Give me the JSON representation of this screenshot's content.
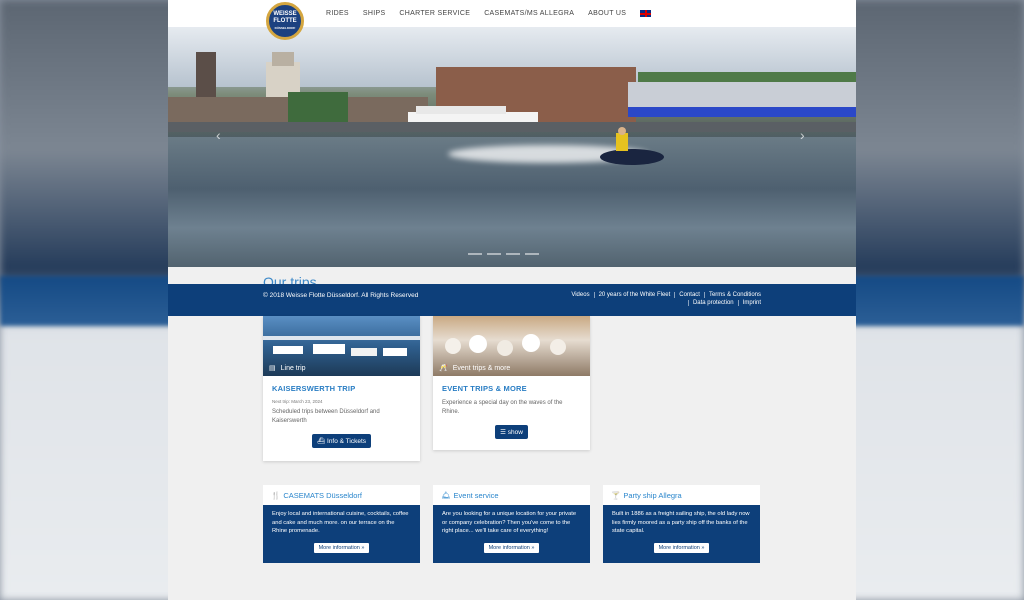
{
  "header": {
    "logo_text": [
      "WEISSE",
      "FLOTTE",
      "DÜSSELDORF"
    ],
    "nav": [
      "RIDES",
      "SHIPS",
      "CHARTER SERVICE",
      "CASEMATS/MS ALLEGRA",
      "ABOUT US"
    ]
  },
  "hero": {
    "prev_icon": "chevron-left-icon",
    "next_icon": "chevron-right-icon"
  },
  "section": {
    "title": "Our trips"
  },
  "footer": {
    "copyright": "© 2018 Weisse Flotte Düsseldorf. All Rights Reserved",
    "links": [
      "Videos",
      "20 years of the White Fleet",
      "Contact",
      "Terms & Conditions",
      "Data protection",
      "Imprint"
    ]
  },
  "cards": [
    {
      "image_label": "Line trip",
      "title": "KAISERSWERTH TRIP",
      "meta": "Next trip: March 23, 2024",
      "text": "Scheduled trips between Düsseldorf and Kaiserswerth",
      "button": "Info & Tickets"
    },
    {
      "image_label": "Event trips & more",
      "title": "EVENT TRIPS & MORE",
      "text": "Experience a special day on the waves of the Rhine.",
      "button": "show"
    }
  ],
  "boxes": [
    {
      "title": "CASEMATS Düsseldorf",
      "text": "Enjoy local and international cuisine, cocktails, coffee and cake and much more. on our terrace on the Rhine promenade.",
      "button": "More information »"
    },
    {
      "title": "Event service",
      "text": "Are you looking for a unique location for your private or company celebration? Then you've come to the right place... we'll take care of everything!",
      "button": "More information »"
    },
    {
      "title": "Party ship Allegra",
      "text": "Built in 1886 as a freight sailing ship, the old lady now lies firmly moored as a party ship off the banks of the state capital.",
      "button": "More information »"
    }
  ],
  "colors": {
    "primary": "#0d3f7a",
    "accent": "#2a7ec4"
  }
}
